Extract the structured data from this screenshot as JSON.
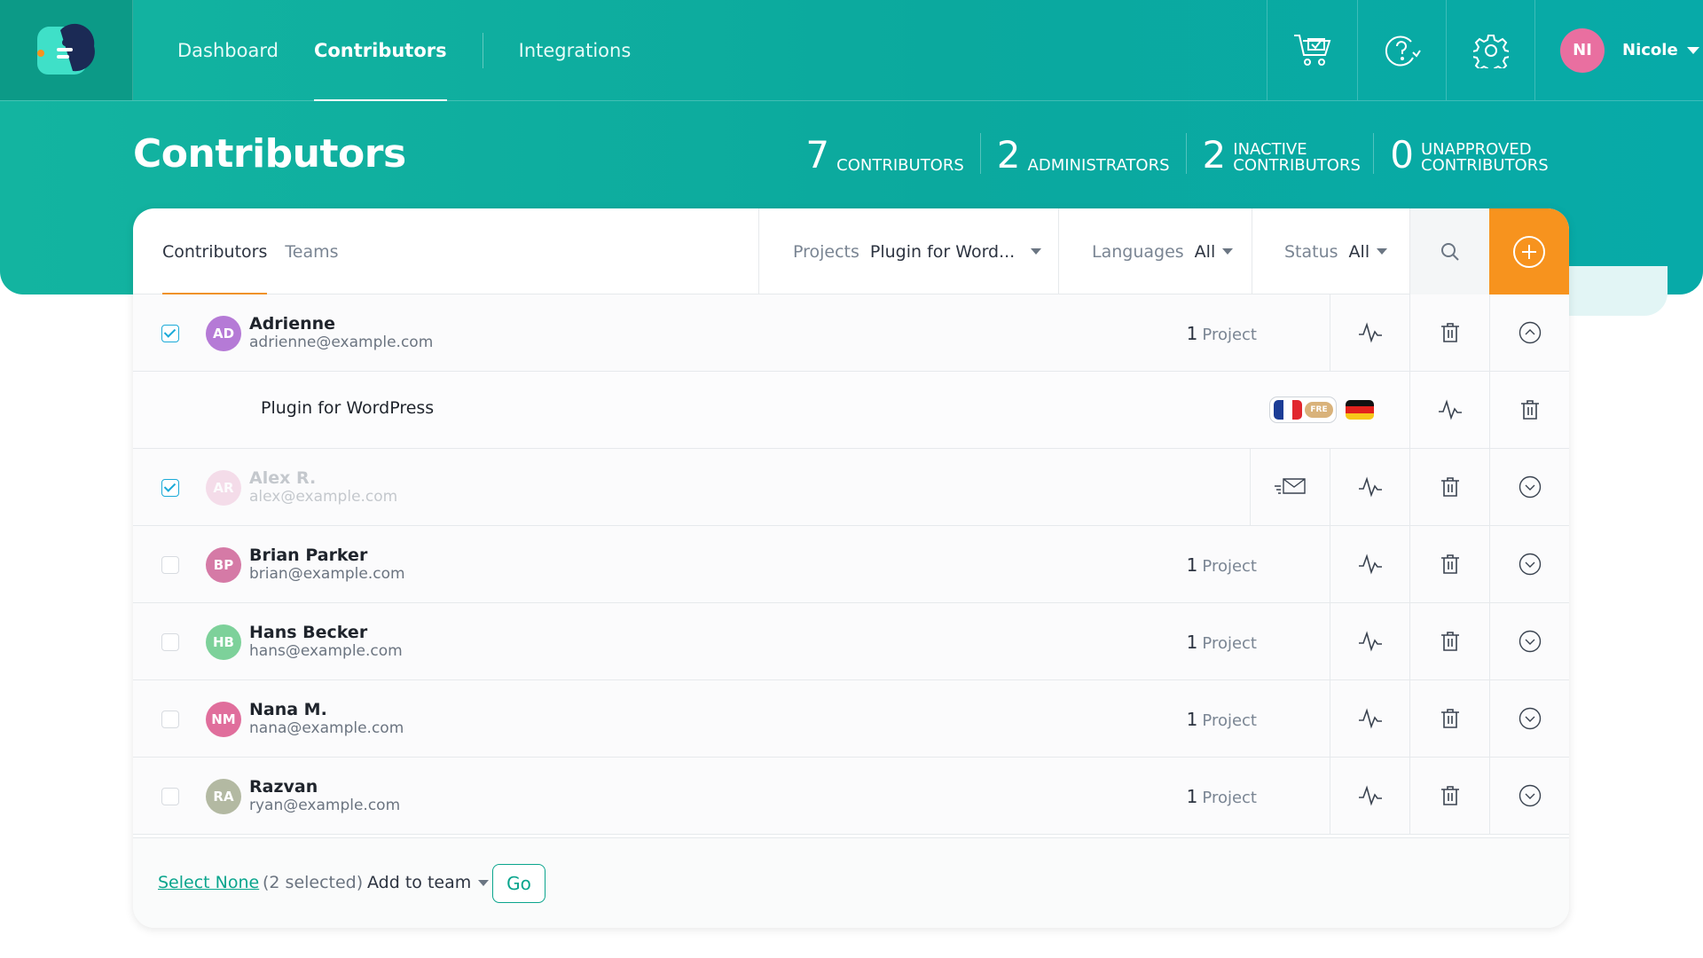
{
  "app": {
    "accent": "#0aa58d",
    "add_color": "#f7931e"
  },
  "nav": {
    "items": [
      "Dashboard",
      "Contributors",
      "Integrations"
    ]
  },
  "user": {
    "initials": "NI",
    "name": "Nicole",
    "avatar_color": "#e96fa0"
  },
  "page": {
    "title": "Contributors"
  },
  "stats": [
    {
      "num": "7",
      "label": "CONTRIBUTORS"
    },
    {
      "num": "2",
      "label": "ADMINISTRATORS"
    },
    {
      "num": "2",
      "label": "INACTIVE CONTRIBUTORS"
    },
    {
      "num": "0",
      "label": "UNAPPROVED CONTRIBUTORS"
    }
  ],
  "tabs": [
    "Contributors",
    "Teams"
  ],
  "filters": {
    "projects": {
      "label": "Projects",
      "value": "Plugin for Word..."
    },
    "languages": {
      "label": "Languages",
      "value": "All"
    },
    "status": {
      "label": "Status",
      "value": "All"
    }
  },
  "contributors": [
    {
      "initials": "AD",
      "name": "Adrienne",
      "email": "adrienne@example.com",
      "projects": "1",
      "projects_label": "Project",
      "checked": true,
      "color": "#b57ad6",
      "expanded": true
    },
    {
      "initials": "AR",
      "name": "Alex R.",
      "email": "alex@example.com",
      "checked": true,
      "color": "#e9a4c8",
      "inactive": true
    },
    {
      "initials": "BP",
      "name": "Brian Parker",
      "email": "brian@example.com",
      "projects": "1",
      "projects_label": "Project",
      "checked": false,
      "color": "#d57aa6"
    },
    {
      "initials": "HB",
      "name": "Hans Becker",
      "email": "hans@example.com",
      "projects": "1",
      "projects_label": "Project",
      "checked": false,
      "color": "#7dd19a"
    },
    {
      "initials": "NM",
      "name": "Nana M.",
      "email": "nana@example.com",
      "projects": "1",
      "projects_label": "Project",
      "checked": false,
      "color": "#e06e9c"
    },
    {
      "initials": "RA",
      "name": "Razvan",
      "email": "ryan@example.com",
      "projects": "1",
      "projects_label": "Project",
      "checked": false,
      "color": "#b3b9a2"
    }
  ],
  "sub_row": {
    "project": "Plugin for WordPress",
    "badge": "FRE"
  },
  "footer": {
    "select_none": "Select None",
    "selected": "(2 selected)",
    "add_to_team": "Add to team",
    "go": "Go"
  }
}
